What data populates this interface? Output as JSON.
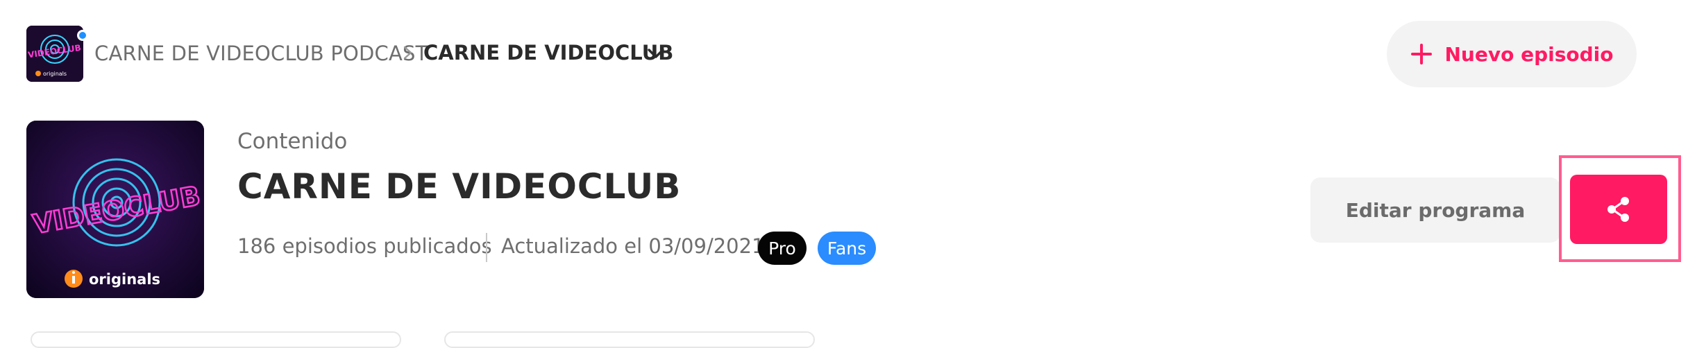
{
  "breadcrumb": {
    "podcast": "CARNE DE VIDEOCLUB PODCAST",
    "show": "CARNE DE VIDEOCLUB"
  },
  "actions": {
    "new_episode": "Nuevo episodio",
    "edit_show": "Editar programa"
  },
  "header": {
    "section_label": "Contenido",
    "title": "CARNE DE VIDEOCLUB",
    "episodes_published": "186 episodios publicados",
    "updated": "Actualizado el 03/09/2021",
    "badges": [
      "Pro",
      "Fans"
    ]
  },
  "cover": {
    "neon_text": "VIDEOCLUB",
    "brand_text": "originals"
  },
  "colors": {
    "accent": "#ff1a63",
    "notification_dot": "#1e90ff",
    "pro_badge": "#050505",
    "fans_badge": "#2a8cff",
    "neon_magenta": "#ff3dd6",
    "neon_cyan": "#36d6ff"
  },
  "icons": [
    "chevron-right-icon",
    "chevron-down-icon",
    "plus-icon",
    "share-icon",
    "originals-logo-icon"
  ]
}
